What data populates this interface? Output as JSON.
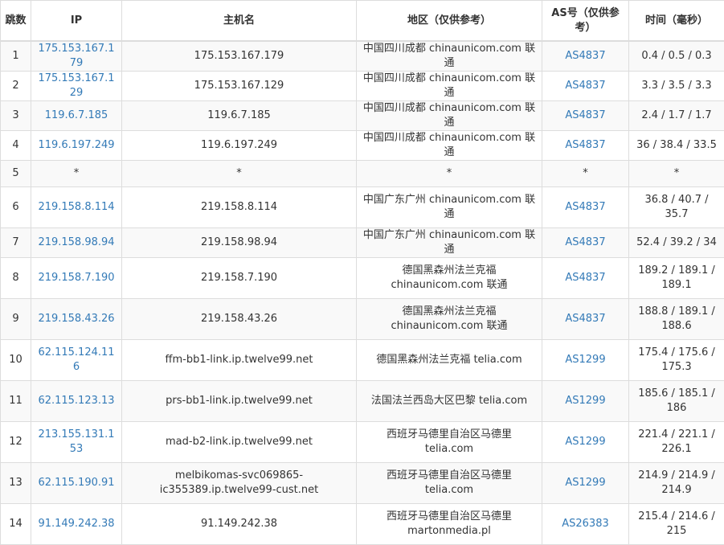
{
  "headers": {
    "hop": "跳数",
    "ip": "IP",
    "hostname": "主机名",
    "region": "地区（仅供参考）",
    "as": "AS号（仅供参考）",
    "time": "时间（毫秒）"
  },
  "rows": [
    {
      "hop": "1",
      "ip": "175.153.167.179",
      "hostname": "175.153.167.179",
      "region": "中国四川成都 chinaunicom.com 联通",
      "as": "AS4837",
      "time": "0.4 / 0.5 / 0.3"
    },
    {
      "hop": "2",
      "ip": "175.153.167.129",
      "hostname": "175.153.167.129",
      "region": "中国四川成都 chinaunicom.com 联通",
      "as": "AS4837",
      "time": "3.3 / 3.5 / 3.3"
    },
    {
      "hop": "3",
      "ip": "119.6.7.185",
      "hostname": "119.6.7.185",
      "region": "中国四川成都 chinaunicom.com 联通",
      "as": "AS4837",
      "time": "2.4 / 1.7 / 1.7"
    },
    {
      "hop": "4",
      "ip": "119.6.197.249",
      "hostname": "119.6.197.249",
      "region": "中国四川成都 chinaunicom.com 联通",
      "as": "AS4837",
      "time": "36 / 38.4 / 33.5"
    },
    {
      "hop": "5",
      "ip": "*",
      "hostname": "*",
      "region": "*",
      "as": "*",
      "time": "*"
    },
    {
      "hop": "6",
      "ip": "219.158.8.114",
      "hostname": "219.158.8.114",
      "region": "中国广东广州 chinaunicom.com 联通",
      "as": "AS4837",
      "time": "36.8 / 40.7 / 35.7"
    },
    {
      "hop": "7",
      "ip": "219.158.98.94",
      "hostname": "219.158.98.94",
      "region": "中国广东广州 chinaunicom.com 联通",
      "as": "AS4837",
      "time": "52.4 / 39.2 / 34"
    },
    {
      "hop": "8",
      "ip": "219.158.7.190",
      "hostname": "219.158.7.190",
      "region": "德国黑森州法兰克福 chinaunicom.com 联通",
      "as": "AS4837",
      "time": "189.2 / 189.1 / 189.1"
    },
    {
      "hop": "9",
      "ip": "219.158.43.26",
      "hostname": "219.158.43.26",
      "region": "德国黑森州法兰克福 chinaunicom.com 联通",
      "as": "AS4837",
      "time": "188.8 / 189.1 / 188.6"
    },
    {
      "hop": "10",
      "ip": "62.115.124.116",
      "hostname": "ffm-bb1-link.ip.twelve99.net",
      "region": "德国黑森州法兰克福 telia.com",
      "as": "AS1299",
      "time": "175.4 / 175.6 / 175.3"
    },
    {
      "hop": "11",
      "ip": "62.115.123.13",
      "hostname": "prs-bb1-link.ip.twelve99.net",
      "region": "法国法兰西岛大区巴黎 telia.com",
      "as": "AS1299",
      "time": "185.6 / 185.1 / 186"
    },
    {
      "hop": "12",
      "ip": "213.155.131.153",
      "hostname": "mad-b2-link.ip.twelve99.net",
      "region": "西班牙马德里自治区马德里 telia.com",
      "as": "AS1299",
      "time": "221.4 / 221.1 / 226.1"
    },
    {
      "hop": "13",
      "ip": "62.115.190.91",
      "hostname": "melbikomas-svc069865-ic355389.ip.twelve99-cust.net",
      "region": "西班牙马德里自治区马德里 telia.com",
      "as": "AS1299",
      "time": "214.9 / 214.9 / 214.9"
    },
    {
      "hop": "14",
      "ip": "91.149.242.38",
      "hostname": "91.149.242.38",
      "region": "西班牙马德里自治区马德里 martonmedia.pl",
      "as": "AS26383",
      "time": "215.4 / 214.6 / 215"
    }
  ]
}
